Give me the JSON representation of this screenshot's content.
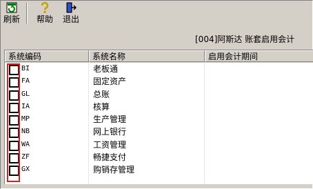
{
  "toolbar": {
    "buttons": [
      {
        "label": "刷新",
        "icon": "refresh-icon"
      },
      {
        "label": "帮助",
        "icon": "help-icon"
      },
      {
        "label": "退出",
        "icon": "exit-icon"
      }
    ]
  },
  "info": "[004]阿斯达 账套启用会计",
  "table": {
    "headers": [
      "系统编码",
      "系统名称",
      "启用会计期间"
    ],
    "rows": [
      {
        "code": "BI",
        "name": "老板通",
        "checked": false
      },
      {
        "code": "FA",
        "name": "固定资产",
        "checked": false
      },
      {
        "code": "GL",
        "name": "总账",
        "checked": false
      },
      {
        "code": "IA",
        "name": "核算",
        "checked": false
      },
      {
        "code": "MP",
        "name": "生产管理",
        "checked": false
      },
      {
        "code": "NB",
        "name": "网上银行",
        "checked": false
      },
      {
        "code": "WA",
        "name": "工资管理",
        "checked": false
      },
      {
        "code": "ZF",
        "name": "畅捷支付",
        "checked": false
      },
      {
        "code": "GX",
        "name": "购销存管理",
        "checked": false
      }
    ]
  },
  "colors": {
    "highlight": "#e21b1b",
    "background": "#d4d0c8"
  }
}
